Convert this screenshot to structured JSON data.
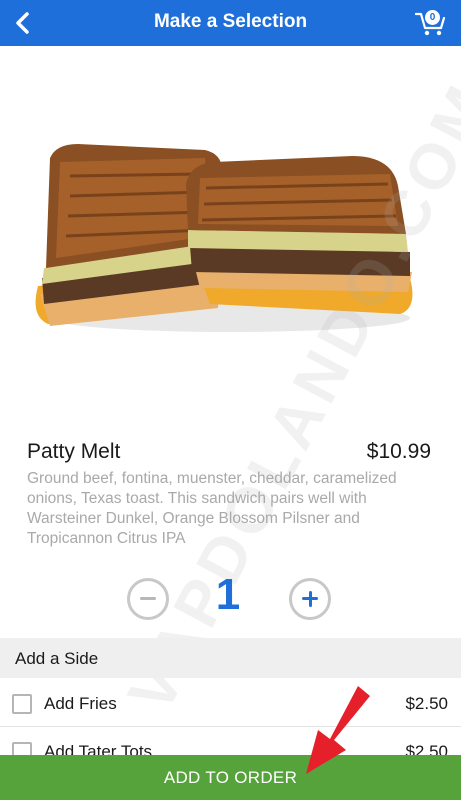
{
  "header": {
    "title": "Make a Selection",
    "back_icon": "chevron-left-icon",
    "cart_icon": "cart-icon",
    "cart_count": "0"
  },
  "watermark": "VAPDOLANDO.COM",
  "item": {
    "name": "Patty Melt",
    "price": "$10.99",
    "description": "Ground beef, fontina, muenster, cheddar, caramelized onions, Texas toast. This sandwich pairs well with Warsteiner Dunkel, Orange Blossom Pilsner and Tropicannon Citrus IPA"
  },
  "quantity": {
    "value": "1",
    "minus_icon": "minus-icon",
    "plus_icon": "plus-icon"
  },
  "side_section": {
    "title": "Add a Side",
    "options": [
      {
        "label": "Add Fries",
        "price": "$2.50",
        "checked": false
      },
      {
        "label": "Add Tater Tots",
        "price": "$2.50",
        "checked": false
      }
    ]
  },
  "footer": {
    "add_label": "ADD TO ORDER"
  },
  "colors": {
    "brand_blue": "#1e6fd9",
    "button_green": "#56a33c",
    "arrow_red": "#e5202a",
    "description_gray": "#a9a9a9"
  }
}
